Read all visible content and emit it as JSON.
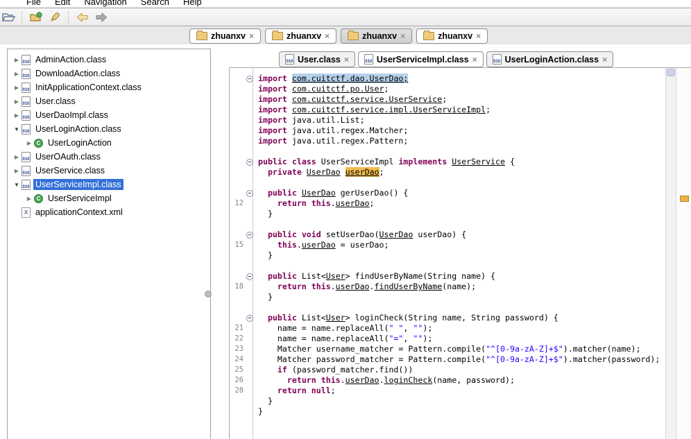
{
  "menu_bar": {
    "items": [
      "File",
      "Edit",
      "Navigation",
      "Search",
      "Help"
    ]
  },
  "toolbar": {
    "icons": [
      "open-file-icon",
      "open-type-icon",
      "search-icon",
      "back-icon",
      "forward-icon"
    ]
  },
  "archive_tabs": {
    "tabs": [
      {
        "label": "zhuanxv",
        "selected": false
      },
      {
        "label": "zhuanxv",
        "selected": false
      },
      {
        "label": "zhuanxv",
        "selected": true
      },
      {
        "label": "zhuanxv",
        "selected": false
      }
    ]
  },
  "editor_tabs": {
    "tabs": [
      {
        "label": "User.class",
        "active": false
      },
      {
        "label": "UserServiceImpl.class",
        "active": true
      },
      {
        "label": "UserLoginAction.class",
        "active": false
      }
    ]
  },
  "tree": {
    "items": [
      {
        "label": "AdminAction.class",
        "icon": "classfile",
        "expander": "collapsed",
        "indent": 0,
        "selected": false
      },
      {
        "label": "DownloadAction.class",
        "icon": "classfile",
        "expander": "collapsed",
        "indent": 0,
        "selected": false
      },
      {
        "label": "InitApplicationContext.class",
        "icon": "classfile",
        "expander": "collapsed",
        "indent": 0,
        "selected": false
      },
      {
        "label": "User.class",
        "icon": "classfile",
        "expander": "collapsed",
        "indent": 0,
        "selected": false
      },
      {
        "label": "UserDaoImpl.class",
        "icon": "classfile",
        "expander": "collapsed",
        "indent": 0,
        "selected": false
      },
      {
        "label": "UserLoginAction.class",
        "icon": "classfile",
        "expander": "expanded",
        "indent": 0,
        "selected": false
      },
      {
        "label": "UserLoginAction",
        "icon": "class",
        "expander": "collapsed",
        "indent": 1,
        "selected": false
      },
      {
        "label": "UserOAuth.class",
        "icon": "classfile",
        "expander": "collapsed",
        "indent": 0,
        "selected": false
      },
      {
        "label": "UserService.class",
        "icon": "classfile",
        "expander": "collapsed",
        "indent": 0,
        "selected": false
      },
      {
        "label": "UserServiceImpl.class",
        "icon": "classfile",
        "expander": "expanded",
        "indent": 0,
        "selected": true
      },
      {
        "label": "UserServiceImpl",
        "icon": "class",
        "expander": "collapsed",
        "indent": 1,
        "selected": false
      },
      {
        "label": "applicationContext.xml",
        "icon": "xml",
        "expander": "none",
        "indent": 0,
        "selected": false
      }
    ]
  },
  "editor": {
    "lines": [
      {
        "fold": true,
        "ind": 0,
        "tok": [
          [
            "k",
            "import "
          ],
          [
            "sel",
            "com.cuitctf.dao.UserDao;"
          ]
        ]
      },
      {
        "ind": 0,
        "tok": [
          [
            "k",
            "import "
          ],
          [
            "l",
            "com.cuitctf.po.User"
          ],
          [
            "p",
            ";"
          ]
        ]
      },
      {
        "ind": 0,
        "tok": [
          [
            "k",
            "import "
          ],
          [
            "l",
            "com.cuitctf.service.UserService"
          ],
          [
            "p",
            ";"
          ]
        ]
      },
      {
        "ind": 0,
        "tok": [
          [
            "k",
            "import "
          ],
          [
            "l",
            "com.cuitctf.service.impl.UserServiceImpl"
          ],
          [
            "p",
            ";"
          ]
        ]
      },
      {
        "ind": 0,
        "tok": [
          [
            "k",
            "import "
          ],
          [
            "p",
            "java.util.List;"
          ]
        ]
      },
      {
        "ind": 0,
        "tok": [
          [
            "k",
            "import "
          ],
          [
            "p",
            "java.util.regex.Matcher;"
          ]
        ]
      },
      {
        "ind": 0,
        "tok": [
          [
            "k",
            "import "
          ],
          [
            "p",
            "java.util.regex.Pattern;"
          ]
        ]
      },
      {
        "ind": 0,
        "tok": []
      },
      {
        "fold": true,
        "ind": 0,
        "tok": [
          [
            "k",
            "public class "
          ],
          [
            "p",
            "UserServiceImpl "
          ],
          [
            "k",
            "implements "
          ],
          [
            "l",
            "UserService"
          ],
          [
            "p",
            " {"
          ]
        ]
      },
      {
        "ind": 2,
        "tok": [
          [
            "k",
            "private "
          ],
          [
            "l",
            "UserDao"
          ],
          [
            "p",
            " "
          ],
          [
            "occ",
            "userDao"
          ],
          [
            "p",
            ";"
          ]
        ]
      },
      {
        "ind": 0,
        "tok": []
      },
      {
        "fold": true,
        "ind": 2,
        "tok": [
          [
            "k",
            "public "
          ],
          [
            "l",
            "UserDao"
          ],
          [
            "p",
            " gerUserDao() {"
          ]
        ]
      },
      {
        "num": "12",
        "ind": 4,
        "tok": [
          [
            "k",
            "return this"
          ],
          [
            "p",
            "."
          ],
          [
            "l",
            "userDao"
          ],
          [
            "p",
            ";"
          ]
        ]
      },
      {
        "ind": 2,
        "tok": [
          [
            "p",
            "}"
          ]
        ]
      },
      {
        "ind": 0,
        "tok": []
      },
      {
        "fold": true,
        "ind": 2,
        "tok": [
          [
            "k",
            "public void "
          ],
          [
            "p",
            "setUserDao("
          ],
          [
            "l",
            "UserDao"
          ],
          [
            "p",
            " userDao) {"
          ]
        ]
      },
      {
        "num": "15",
        "ind": 4,
        "tok": [
          [
            "k",
            "this"
          ],
          [
            "p",
            "."
          ],
          [
            "l",
            "userDao"
          ],
          [
            "p",
            " = userDao;"
          ]
        ]
      },
      {
        "ind": 2,
        "tok": [
          [
            "p",
            "}"
          ]
        ]
      },
      {
        "ind": 0,
        "tok": []
      },
      {
        "fold": true,
        "ind": 2,
        "tok": [
          [
            "k",
            "public "
          ],
          [
            "p",
            "List<"
          ],
          [
            "l",
            "User"
          ],
          [
            "p",
            "> findUserByName(String name) {"
          ]
        ]
      },
      {
        "num": "18",
        "ind": 4,
        "tok": [
          [
            "k",
            "return this"
          ],
          [
            "p",
            "."
          ],
          [
            "l",
            "userDao"
          ],
          [
            "p",
            "."
          ],
          [
            "l",
            "findUserByName"
          ],
          [
            "p",
            "(name);"
          ]
        ]
      },
      {
        "ind": 2,
        "tok": [
          [
            "p",
            "}"
          ]
        ]
      },
      {
        "ind": 0,
        "tok": []
      },
      {
        "fold": true,
        "ind": 2,
        "tok": [
          [
            "k",
            "public "
          ],
          [
            "p",
            "List<"
          ],
          [
            "l",
            "User"
          ],
          [
            "p",
            "> loginCheck(String name, String password) {"
          ]
        ]
      },
      {
        "num": "21",
        "ind": 4,
        "tok": [
          [
            "p",
            "name = name.replaceAll("
          ],
          [
            "s",
            "\" \""
          ],
          [
            "p",
            ", "
          ],
          [
            "s",
            "\"\""
          ],
          [
            "p",
            ");"
          ]
        ]
      },
      {
        "num": "22",
        "ind": 4,
        "tok": [
          [
            "p",
            "name = name.replaceAll("
          ],
          [
            "s",
            "\"=\""
          ],
          [
            "p",
            ", "
          ],
          [
            "s",
            "\"\""
          ],
          [
            "p",
            ");"
          ]
        ]
      },
      {
        "num": "23",
        "ind": 4,
        "tok": [
          [
            "p",
            "Matcher username_matcher = Pattern.compile("
          ],
          [
            "s",
            "\"^[0-9a-zA-Z]+$\""
          ],
          [
            "p",
            ").matcher(name);"
          ]
        ]
      },
      {
        "num": "24",
        "ind": 4,
        "tok": [
          [
            "p",
            "Matcher password_matcher = Pattern.compile("
          ],
          [
            "s",
            "\"^[0-9a-zA-Z]+$\""
          ],
          [
            "p",
            ").matcher(password);"
          ]
        ]
      },
      {
        "num": "25",
        "ind": 4,
        "tok": [
          [
            "k",
            "if"
          ],
          [
            "p",
            " (password_matcher.find())"
          ]
        ]
      },
      {
        "num": "26",
        "ind": 6,
        "tok": [
          [
            "k",
            "return this"
          ],
          [
            "p",
            "."
          ],
          [
            "l",
            "userDao"
          ],
          [
            "p",
            "."
          ],
          [
            "l",
            "loginCheck"
          ],
          [
            "p",
            "(name, password);"
          ]
        ]
      },
      {
        "num": "28",
        "ind": 4,
        "tok": [
          [
            "k",
            "return null"
          ],
          [
            "p",
            ";"
          ]
        ]
      },
      {
        "ind": 2,
        "tok": [
          [
            "p",
            "}"
          ]
        ]
      },
      {
        "ind": 0,
        "tok": [
          [
            "p",
            "}"
          ]
        ]
      }
    ]
  },
  "colors": {
    "keyword": "#7f0055",
    "string": "#2a00ff",
    "selection_blue": "#b5d1ea",
    "occurrence_orange": "#eebb4d",
    "tree_selection": "#3472d8",
    "ruler_marker": "#e9b445"
  }
}
